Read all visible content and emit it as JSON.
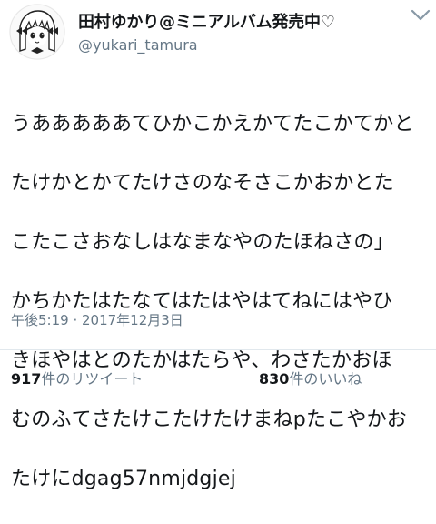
{
  "tweet": {
    "author": {
      "display_name": "田村ゆかり@ミニアルバム発売中♡",
      "handle": "@yukari_tamura",
      "avatar_icon": "avatar-illustration-icon"
    },
    "text_lines": [
      "うあああああてひかこかえかてたこかてかと",
      "たけかとかてたけさのなそさこかおかとた",
      "こたこさおなしはなまなやのたほねさの」",
      "かちかたはたなてはたはやはてねにはやひ",
      "きほやはとのたかはたらや、わさたかおほ",
      "むのふてさたけこたけたけまねpたこやかお",
      "たけにdgag57nmjdgjej"
    ],
    "timestamp": "午後5:19 · 2017年12月3日",
    "stats": {
      "retweets_count": "917",
      "retweets_label": "件のリツイート",
      "likes_count": "830",
      "likes_label": "件のいいね"
    },
    "menu_icon": "chevron-down-icon"
  }
}
